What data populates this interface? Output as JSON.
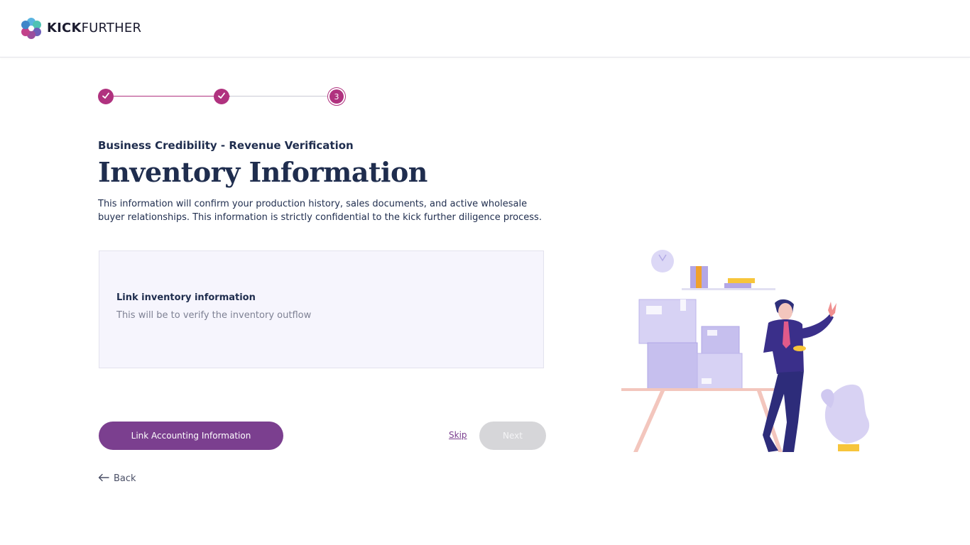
{
  "brand": {
    "name_bold": "KICK",
    "name_rest": "FURTHER",
    "logo_icon": "flower-logo-icon"
  },
  "stepper": {
    "steps": [
      {
        "state": "complete",
        "icon": "check-icon"
      },
      {
        "state": "complete",
        "icon": "check-icon"
      },
      {
        "state": "current",
        "label": "3"
      }
    ]
  },
  "page": {
    "eyebrow": "Business Credibility - Revenue Verification",
    "title": "Inventory Information",
    "description": "This information will confirm your production history, sales documents, and active wholesale buyer relationships. This information is strictly confidential to the kick further diligence process."
  },
  "card": {
    "title": "Link inventory information",
    "subtitle": "This will be to verify the inventory outflow"
  },
  "actions": {
    "primary_label": "Link Accounting Information",
    "skip_label": "Skip",
    "next_label": "Next",
    "back_label": "Back",
    "back_icon": "arrow-left-icon"
  },
  "colors": {
    "accent": "#b0327f",
    "primary_button": "#7b3f8f",
    "disabled_button": "#d6d6d9",
    "navy_text": "#1f2d4e",
    "card_bg": "#f6f5fd"
  }
}
